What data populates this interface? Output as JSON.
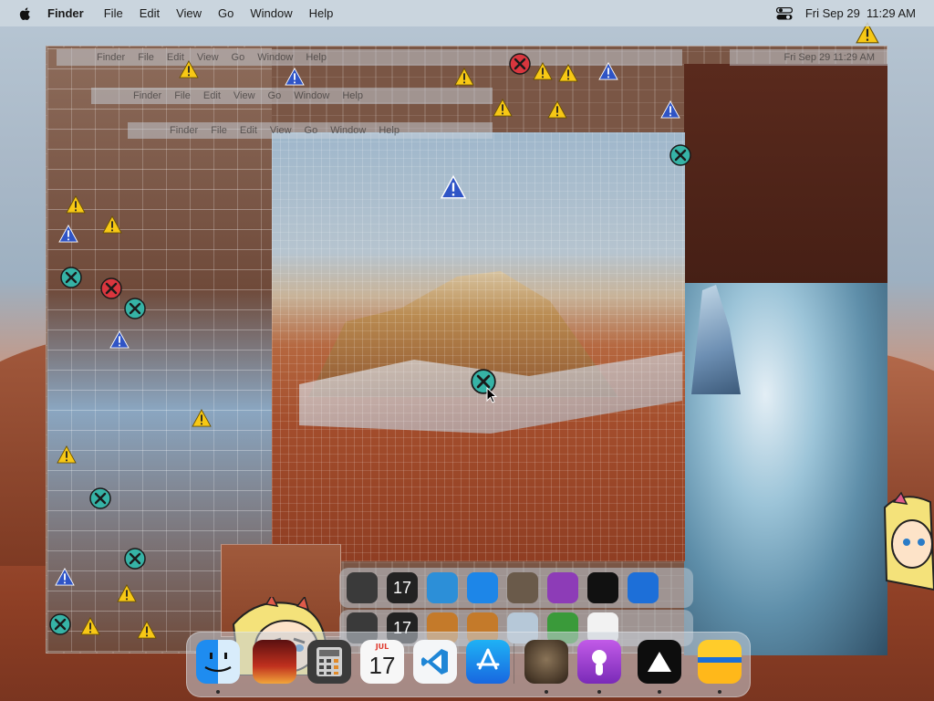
{
  "menubar": {
    "app_name": "Finder",
    "menus": [
      "File",
      "Edit",
      "View",
      "Go",
      "Window",
      "Help"
    ],
    "clock": "Fri Sep 29  11:29 AM"
  },
  "ghost_menubars": [
    {
      "items": [
        "Finder",
        "File",
        "Edit",
        "View",
        "Go",
        "Window",
        "Help"
      ],
      "clock": "Fri Sep 29  11:29 AM"
    },
    {
      "items": [
        "Finder",
        "File",
        "Edit",
        "View",
        "Go",
        "Window",
        "Help"
      ]
    },
    {
      "items": [
        "Finder",
        "File",
        "Edit",
        "View",
        "Go",
        "Window",
        "Help"
      ]
    }
  ],
  "dock": {
    "apps": [
      {
        "name": "Finder",
        "icon": "finder-icon",
        "running": true
      },
      {
        "name": "Photo Booth",
        "icon": "photo-booth-icon",
        "running": false
      },
      {
        "name": "Calculator",
        "icon": "calculator-icon",
        "running": false
      },
      {
        "name": "Calendar",
        "icon": "calendar-icon",
        "running": false,
        "month": "JUL",
        "day": "17"
      },
      {
        "name": "Visual Studio Code",
        "icon": "vscode-icon",
        "running": false
      },
      {
        "name": "App Store",
        "icon": "app-store-icon",
        "running": false
      },
      {
        "name": "Image",
        "icon": "image-icon",
        "running": true
      },
      {
        "name": "Podcast",
        "icon": "podcast-icon",
        "running": true
      },
      {
        "name": "Warning App",
        "icon": "warning-app-icon",
        "running": true
      },
      {
        "name": "Folder",
        "icon": "yellow-folder-icon",
        "running": true
      }
    ]
  },
  "colors": {
    "warning_yellow": "#f7c815",
    "warning_blue": "#2f54c6",
    "error_teal": "#36b3a6",
    "error_red": "#d9363e"
  }
}
